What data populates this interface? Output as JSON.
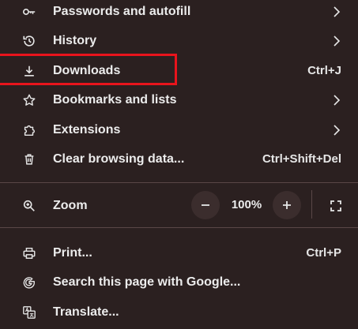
{
  "menu": {
    "items": [
      {
        "label": "Passwords and autofill",
        "icon": "key-icon",
        "shortcut": "",
        "has_submenu": true
      },
      {
        "label": "History",
        "icon": "history-icon",
        "shortcut": "",
        "has_submenu": true
      },
      {
        "label": "Downloads",
        "icon": "download-icon",
        "shortcut": "Ctrl+J",
        "has_submenu": false
      },
      {
        "label": "Bookmarks and lists",
        "icon": "star-icon",
        "shortcut": "",
        "has_submenu": true
      },
      {
        "label": "Extensions",
        "icon": "puzzle-icon",
        "shortcut": "",
        "has_submenu": true
      },
      {
        "label": "Clear browsing data...",
        "icon": "trash-icon",
        "shortcut": "Ctrl+Shift+Del",
        "has_submenu": false
      }
    ],
    "zoom": {
      "label": "Zoom",
      "icon": "zoom-icon",
      "value": "100%",
      "minus": "−",
      "plus": "+",
      "fullscreen_icon": "fullscreen-icon"
    },
    "items2": [
      {
        "label": "Print...",
        "icon": "print-icon",
        "shortcut": "Ctrl+P"
      },
      {
        "label": "Search this page with Google...",
        "icon": "google-icon",
        "shortcut": ""
      },
      {
        "label": "Translate...",
        "icon": "translate-icon",
        "shortcut": ""
      }
    ]
  },
  "colors": {
    "background": "#2b2020",
    "highlight_border": "#e8141c",
    "text": "#ececec"
  }
}
